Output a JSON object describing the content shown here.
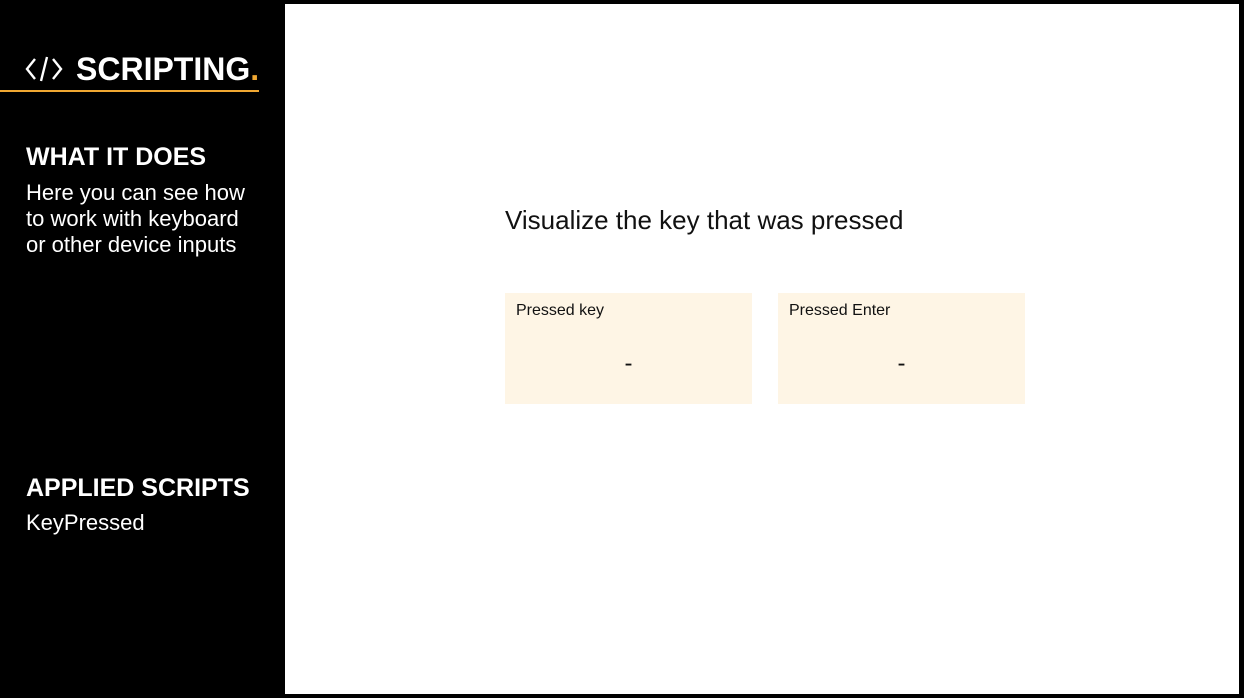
{
  "sidebar": {
    "brand": {
      "icon": "code-brackets-icon",
      "title": "SCRIPTING",
      "dot": ".",
      "accent_color": "#f0a832"
    },
    "what_it_does": {
      "heading": "WHAT IT DOES",
      "text_line1": "Here you can see how",
      "text_line2": "to work with keyboard",
      "text_line3": "or other device inputs"
    },
    "applied_scripts": {
      "heading": "APPLIED SCRIPTS",
      "text": "KeyPressed"
    }
  },
  "main": {
    "headline": "Visualize the key that was pressed",
    "cards": [
      {
        "label": "Pressed key",
        "value": "-"
      },
      {
        "label": "Pressed Enter",
        "value": "-"
      }
    ],
    "card_color": "#fef5e5"
  }
}
